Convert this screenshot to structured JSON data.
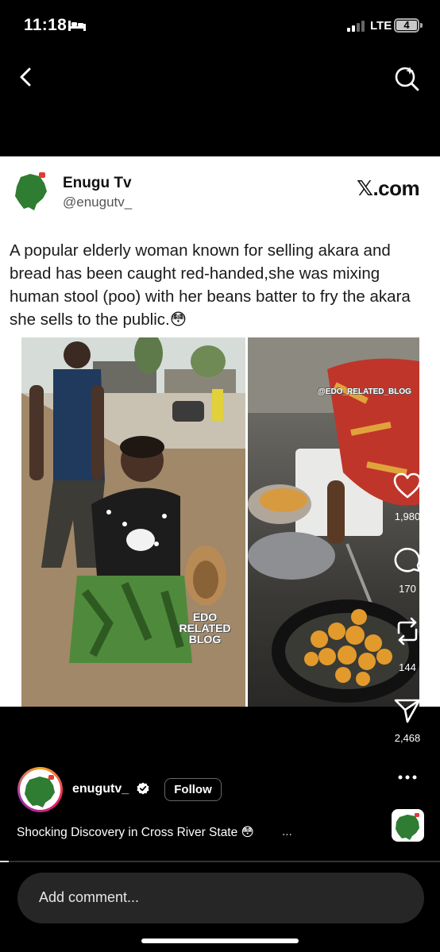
{
  "status_bar": {
    "time": "11:18",
    "network": "LTE",
    "battery": "4"
  },
  "post": {
    "author_name": "Enugu Tv",
    "author_handle": "@enugutv_",
    "brand": "𝕏.com",
    "text": "A popular elderly woman known for selling akara and bread has been caught red-handed,she was mixing human stool (poo) with her beans batter to fry the akara she sells to the public.😳",
    "watermark_left": "EDO RELATED BLOG",
    "watermark_right": "@EDO_RELATED_BLOG"
  },
  "actions": {
    "likes": "1,980",
    "comments": "170",
    "reposts": "144",
    "shares": "2,468"
  },
  "author": {
    "username": "enugutv_",
    "follow_label": "Follow",
    "caption": "Shocking Discovery in Cross River State 😳",
    "caption_more": "..."
  },
  "video_progress": 0.02,
  "comment": {
    "placeholder": "Add comment..."
  },
  "colors": {
    "background": "#000000",
    "card": "#ffffff",
    "comment_bar": "#262626"
  },
  "icons": [
    "back-chevron-icon",
    "search-sparkle-icon",
    "heart-icon",
    "comment-icon",
    "repost-icon",
    "share-icon",
    "more-icon",
    "verified-icon"
  ]
}
